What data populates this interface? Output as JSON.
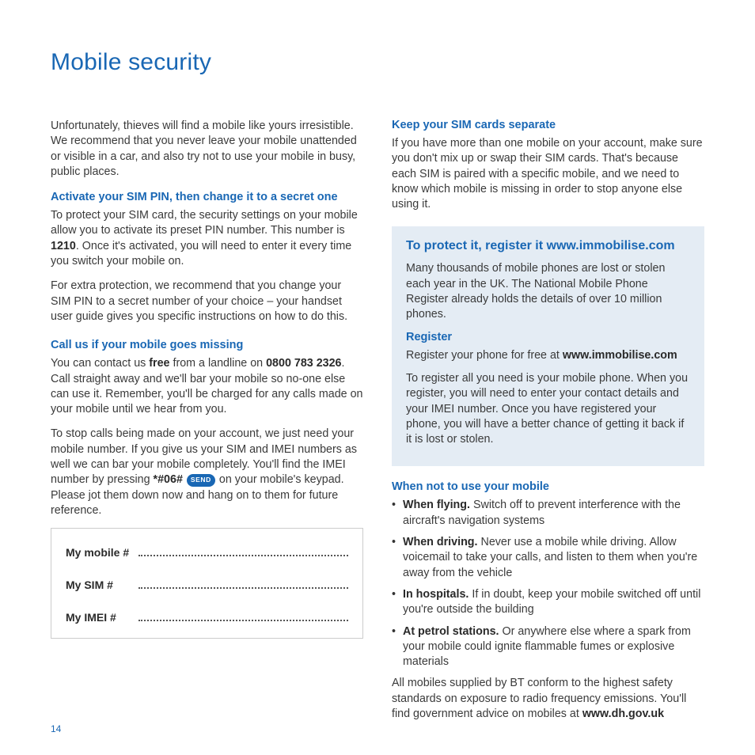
{
  "title": "Mobile security",
  "page_number": "14",
  "left": {
    "intro": "Unfortunately, thieves will find a mobile like yours irresistible. We recommend that you never leave your mobile unattended or visible in a car, and also try not to use your mobile in busy, public places.",
    "sec1_h": "Activate your SIM PIN, then change it to a secret one",
    "sec1_p1a": "To protect your SIM card, the security settings on your mobile allow you to activate its preset PIN number. This number is ",
    "sec1_pin": "1210",
    "sec1_p1b": ". Once it's activated, you will need to enter it every time you switch your mobile on.",
    "sec1_p2": "For extra protection, we recommend that you change your SIM PIN to a secret number of your choice – your handset user guide gives you specific instructions on how to do this.",
    "sec2_h": "Call us if your mobile goes missing",
    "sec2_p1a": "You can contact us ",
    "sec2_free": "free",
    "sec2_p1b": " from a landline on ",
    "sec2_phone": "0800 783 2326",
    "sec2_p1c": ". Call straight away and we'll bar your mobile so no-one else can use it. Remember, you'll be charged for any calls made on your mobile until we hear from you.",
    "sec2_p2a": "To stop calls being made on your account, we just need your mobile number. If you give us your SIM and IMEI numbers as well we can bar your mobile completely. You'll find the IMEI number by pressing ",
    "sec2_code": "*#06#",
    "sec2_send": "SEND",
    "sec2_p2b": " on your mobile's keypad. Please jot them down now and hang on to them for future reference.",
    "box": {
      "row1": "My mobile #",
      "row2": "My SIM #",
      "row3": "My IMEI #"
    }
  },
  "right": {
    "sec1_h": "Keep your SIM cards separate",
    "sec1_p": "If you have more than one mobile on your account, make sure you don't mix up or swap their SIM cards. That's because each SIM is paired with a specific mobile, and we need to know which mobile is missing in order to stop anyone else using it.",
    "callout": {
      "title": "To protect it, register it www.immobilise.com",
      "p1": "Many thousands of mobile phones are lost or stolen each year in the UK. The National Mobile Phone Register already holds the details of over 10 million phones.",
      "reg_h": "Register",
      "reg_p1a": "Register your phone for free at ",
      "reg_url": "www.immobilise.com",
      "reg_p2": "To register all you need is your mobile phone. When you register, you will need to enter your contact details and your IMEI number. Once you have registered your phone, you will have a better chance of getting it back if it is lost or stolen."
    },
    "when_h": "When not to use your mobile",
    "bullets": [
      {
        "lead": "When flying.",
        "text": " Switch off to prevent interference with the aircraft's navigation systems"
      },
      {
        "lead": "When driving.",
        "text": " Never use a mobile while driving. Allow voicemail to take your calls, and listen to them when you're away from the vehicle"
      },
      {
        "lead": "In hospitals.",
        "text": " If in doubt, keep your mobile switched off until you're outside the building"
      },
      {
        "lead": "At petrol stations.",
        "text": " Or anywhere else where a spark from your mobile could ignite flammable fumes or explosive materials"
      }
    ],
    "closing_a": "All mobiles supplied by BT conform to the highest safety standards on exposure to radio frequency emissions. You'll find government advice on mobiles at ",
    "closing_url": "www.dh.gov.uk"
  }
}
